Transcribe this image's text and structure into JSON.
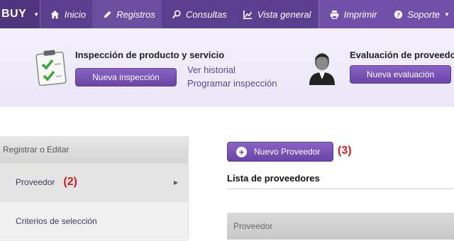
{
  "nav": {
    "brand": "BUY",
    "items": [
      {
        "label": "Inicio"
      },
      {
        "label": "Registros"
      },
      {
        "label": "Consultas"
      },
      {
        "label": "Vista general"
      },
      {
        "label": "Imprimir"
      },
      {
        "label": "Soporte"
      }
    ]
  },
  "banner": {
    "inspection": {
      "title": "Inspección de producto y servicio",
      "button": "Nueva inspección",
      "links": [
        "Ver historial",
        "Programar inspección"
      ]
    },
    "evaluation": {
      "title": "Evaluación de proveedores",
      "button": "Nueva evaluación"
    }
  },
  "sidebar": {
    "header": "Registrar o Editar",
    "items": [
      {
        "label": "Proveedor",
        "marker": "(2)"
      },
      {
        "label": "Criterios de selección"
      }
    ]
  },
  "main": {
    "new_button": "Nuevo Proveedor",
    "marker": "(3)",
    "list_title": "Lista de proveedores",
    "table_header": "Proveedor"
  }
}
